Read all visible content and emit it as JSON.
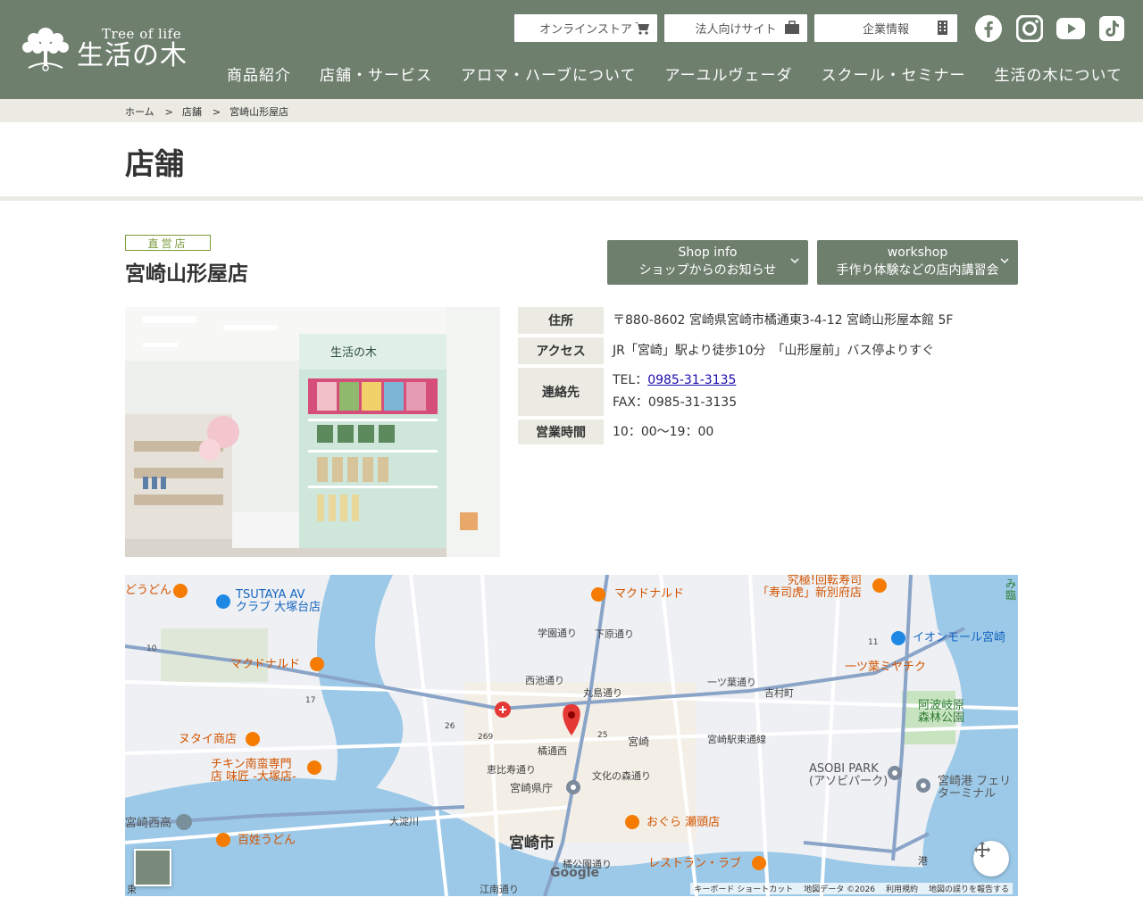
{
  "brand": {
    "tagline_en": "Tree of life",
    "name_jp": "生活の木"
  },
  "top_links": [
    {
      "label": "オンラインストア",
      "icon": "cart-icon"
    },
    {
      "label": "法人向けサイト",
      "icon": "briefcase-icon"
    },
    {
      "label": "企業情報",
      "icon": "building-icon"
    }
  ],
  "social": [
    "facebook-icon",
    "instagram-icon",
    "youtube-icon",
    "tiktok-icon"
  ],
  "nav": [
    "商品紹介",
    "店舗・サービス",
    "アロマ・ハーブについて",
    "アーユルヴェーダ",
    "スクール・セミナー",
    "生活の木について"
  ],
  "breadcrumb": {
    "home": "ホーム",
    "sep": ">",
    "level1": "店舗",
    "current": "宮崎山形屋店"
  },
  "page_title": "店舗",
  "shop": {
    "badge": "直営店",
    "name": "宮崎山形屋店",
    "buttons": [
      {
        "line1": "Shop info",
        "line2": "ショップからのお知らせ"
      },
      {
        "line1": "workshop",
        "line2": "手作り体験などの店内講習会"
      }
    ],
    "info": {
      "address_label": "住所",
      "address": "〒880-8602 宮崎県宮崎市橘通東3-4-12 宮崎山形屋本館 5F",
      "access_label": "アクセス",
      "access": "JR「宮崎」駅より徒歩10分　「山形屋前」バス停よりすぐ",
      "contact_label": "連絡先",
      "tel_prefix": "TEL：",
      "tel": "0985-31-3135",
      "fax": "FAX：0985-31-3135",
      "hours_label": "営業時間",
      "hours": "10：00～19：00"
    }
  },
  "photo": {
    "sign": "生活の木"
  },
  "map": {
    "labels": {
      "udon_top": "どうどん",
      "tsutaya": "TSUTAYA AV\nクラブ 大塚台店",
      "mcd_top": "マクドナルド",
      "sushi": "究極!回転寿司\n「寿司虎」新別府店",
      "aeon": "イオンモール宮崎",
      "mcd_left": "マクドナルド",
      "mitsuba": "一ツ葉ミヤチク",
      "anabae": "阿波岐原\n森林公園",
      "nutai": "ヌタイ商店",
      "chicken": "チキン南蛮専門\n店 味匠 -大塚店-",
      "asobi": "ASOBI PARK\n(アソビパーク)",
      "port": "宮崎港 フェリ\nターミナル",
      "okura": "おぐら 瀬頭店",
      "miyazaki_nishi": "宮崎西高",
      "hyakusho": "百姓うどん",
      "love": "レストラン・ラブ",
      "city": "宮崎市",
      "pref": "宮崎県庁",
      "station": "宮崎",
      "tachibana": "橘通西",
      "gakuen": "学園通り",
      "shimohara": "下原通り",
      "nishiike": "西池通り",
      "marushima": "丸島通り",
      "hitotsuba": "一ツ葉通り",
      "yoshimura": "吉村町",
      "ebisu": "恵比寿通り",
      "bunka": "文化の森通り",
      "eki_higashi": "宮崎駅東通線",
      "oyodo": "大淀川",
      "konan": "江南通り",
      "tachibana_koen": "橘公園通り",
      "minato": "港",
      "mi": "み",
      "rin": "臨",
      "higashi": "東",
      "road_10": "10",
      "road_17": "17",
      "road_26": "26",
      "road_269": "269",
      "road_25": "25",
      "road_11": "11"
    },
    "google": "Google",
    "footer": {
      "keyboard": "キーボード ショートカット",
      "data": "地図データ ©2026",
      "terms": "利用規約",
      "report": "地図の誤りを報告する"
    }
  },
  "colors": {
    "header_bg": "#6f7f6e",
    "badge_green": "#7a9a3a",
    "light_band": "#ebebe3"
  }
}
